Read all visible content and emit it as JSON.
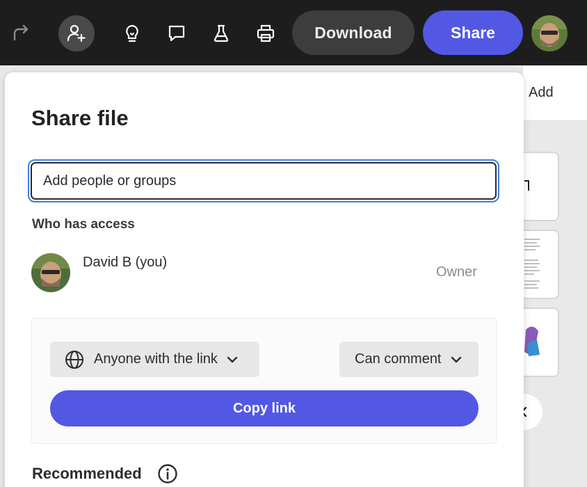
{
  "toolbar": {
    "download_label": "Download",
    "share_label": "Share",
    "icons": [
      "redo-icon",
      "add-person-icon",
      "lightbulb-icon",
      "comment-icon",
      "flask-icon",
      "print-icon"
    ]
  },
  "background": {
    "add_label": "Add"
  },
  "share_panel": {
    "title": "Share file",
    "search": {
      "placeholder": "Add people or groups",
      "value": ""
    },
    "access_heading": "Who has access",
    "users": [
      {
        "name": "David B (you)",
        "role": "Owner"
      }
    ],
    "link_settings": {
      "access_option": "Anyone with the link",
      "permission_option": "Can comment",
      "copy_label": "Copy link"
    },
    "recommended_heading": "Recommended"
  },
  "colors": {
    "accent": "#5258e4",
    "toolbar_bg": "#1d1d1d",
    "focus_ring": "#3b7ee0"
  }
}
